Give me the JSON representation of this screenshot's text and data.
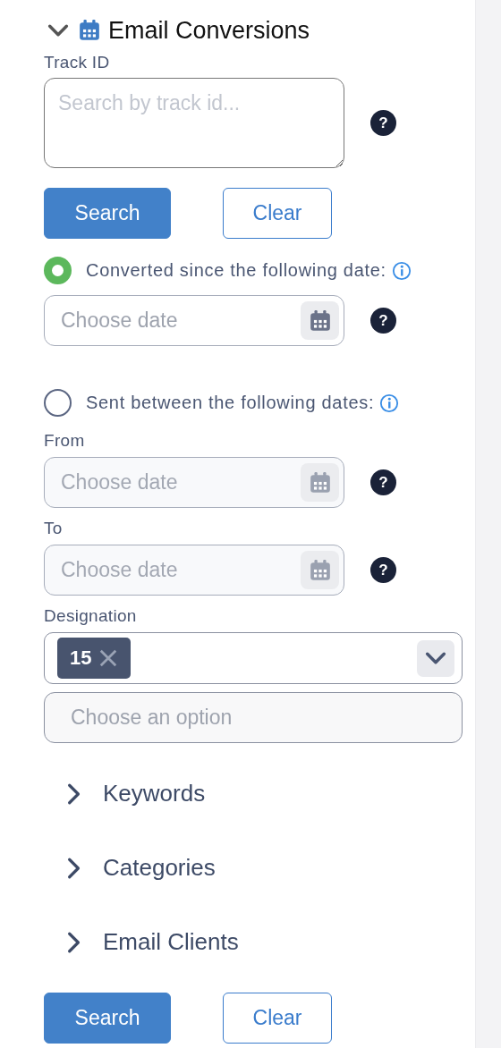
{
  "section": {
    "title": "Email Conversions",
    "expanded": true
  },
  "track_id": {
    "label": "Track ID",
    "placeholder": "Search by track id...",
    "help": "?"
  },
  "track_buttons": [
    {
      "label": "Search",
      "kind": "primary"
    },
    {
      "label": "Clear",
      "kind": "secondary"
    }
  ],
  "date_options": [
    {
      "label": "Converted since the following date:",
      "selected": true,
      "fields": [
        {
          "placeholder": "Choose date",
          "disabled": false,
          "help": "?"
        }
      ]
    },
    {
      "label": "Sent between the following dates:",
      "selected": false,
      "fields": [
        {
          "label": "From",
          "placeholder": "Choose date",
          "disabled": true,
          "help": "?"
        },
        {
          "label": "To",
          "placeholder": "Choose date",
          "disabled": true,
          "help": "?"
        }
      ]
    }
  ],
  "designation": {
    "label": "Designation",
    "tags": [
      "15"
    ],
    "placeholder": "Choose an option"
  },
  "filters": [
    {
      "title": "Keywords",
      "expanded": false
    },
    {
      "title": "Categories",
      "expanded": false
    },
    {
      "title": "Email Clients",
      "expanded": false
    }
  ],
  "buttons": [
    {
      "label": "Search",
      "kind": "primary"
    },
    {
      "label": "Clear",
      "kind": "secondary"
    }
  ]
}
